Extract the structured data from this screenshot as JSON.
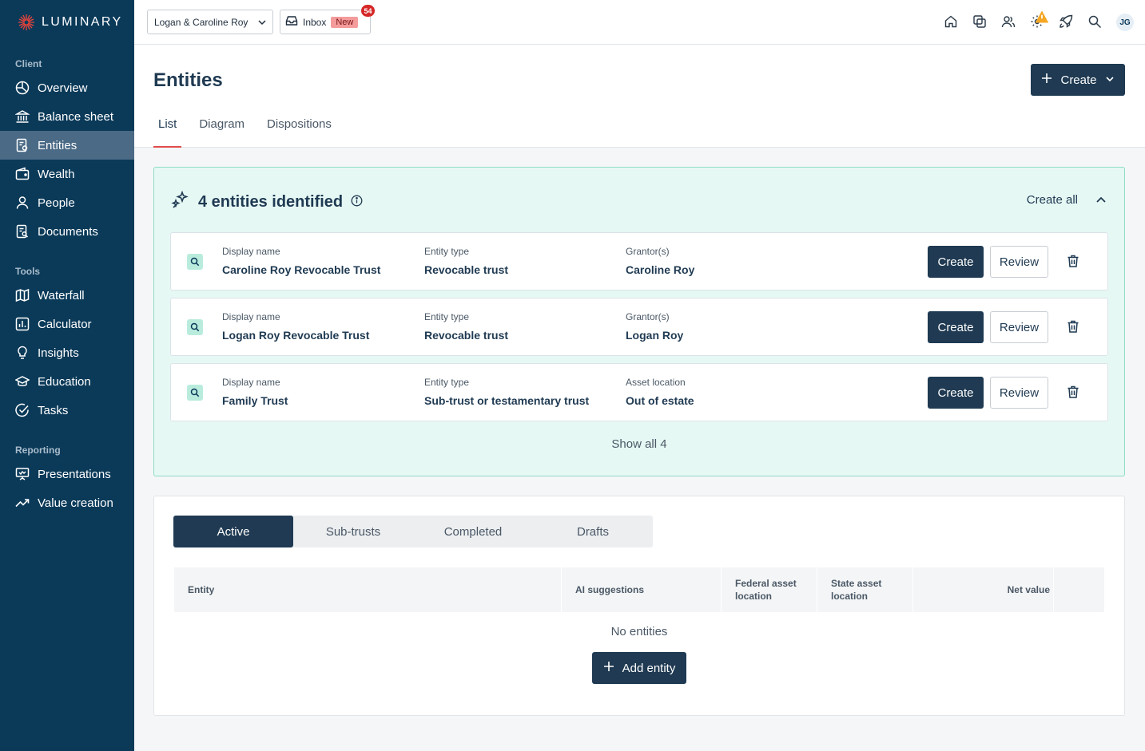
{
  "app": {
    "brand": "LUMINARY"
  },
  "colors": {
    "sidebar": "#0b3a59",
    "primary": "#1f3a52",
    "accent": "#e24b4b",
    "ai_panel": "#e6f8f4",
    "ai_border": "#8fdcc7"
  },
  "sidebar": {
    "sections": [
      {
        "label": "Client",
        "items": [
          {
            "label": "Overview",
            "icon": "pie-chart-icon",
            "active": false
          },
          {
            "label": "Balance sheet",
            "icon": "bank-icon",
            "active": false
          },
          {
            "label": "Entities",
            "icon": "entity-document-icon",
            "active": true
          },
          {
            "label": "Wealth",
            "icon": "wallet-icon",
            "active": false
          },
          {
            "label": "People",
            "icon": "person-icon",
            "active": false
          },
          {
            "label": "Documents",
            "icon": "document-search-icon",
            "active": false
          }
        ]
      },
      {
        "label": "Tools",
        "items": [
          {
            "label": "Waterfall",
            "icon": "map-icon",
            "active": false
          },
          {
            "label": "Calculator",
            "icon": "bar-chart-icon",
            "active": false
          },
          {
            "label": "Insights",
            "icon": "lightbulb-icon",
            "active": false
          },
          {
            "label": "Education",
            "icon": "graduation-cap-icon",
            "active": false
          },
          {
            "label": "Tasks",
            "icon": "check-circle-icon",
            "active": false
          }
        ]
      },
      {
        "label": "Reporting",
        "items": [
          {
            "label": "Presentations",
            "icon": "presentation-icon",
            "active": false
          },
          {
            "label": "Value creation",
            "icon": "trending-up-icon",
            "active": false
          }
        ]
      }
    ]
  },
  "topbar": {
    "client": "Logan & Caroline Roy",
    "inbox_label": "Inbox",
    "inbox_new": "New",
    "inbox_count": "54",
    "avatar_initials": "JG",
    "icons": [
      "home-icon",
      "copy-icon",
      "users-icon",
      "settings-warning-icon",
      "rocket-icon",
      "search-icon"
    ]
  },
  "page": {
    "title": "Entities",
    "create_label": "Create",
    "tabs": [
      "List",
      "Diagram",
      "Dispositions"
    ],
    "active_tab": "List"
  },
  "ai": {
    "title": "4 entities identified",
    "create_all": "Create all",
    "show_all": "Show all 4",
    "create_label": "Create",
    "review_label": "Review",
    "entities": [
      {
        "c1_label": "Display name",
        "c1_value": "Caroline Roy Revocable Trust",
        "c2_label": "Entity type",
        "c2_value": "Revocable trust",
        "c3_label": "Grantor(s)",
        "c3_value": "Caroline Roy"
      },
      {
        "c1_label": "Display name",
        "c1_value": "Logan Roy Revocable Trust",
        "c2_label": "Entity type",
        "c2_value": "Revocable trust",
        "c3_label": "Grantor(s)",
        "c3_value": "Logan Roy"
      },
      {
        "c1_label": "Display name",
        "c1_value": "Family Trust",
        "c2_label": "Entity type",
        "c2_value": "Sub-trust or testamentary trust",
        "c3_label": "Asset location",
        "c3_value": "Out of estate"
      }
    ]
  },
  "table": {
    "segments": [
      "Active",
      "Sub-trusts",
      "Completed",
      "Drafts"
    ],
    "active_segment": "Active",
    "columns": [
      "Entity",
      "AI suggestions",
      "Federal asset location",
      "State asset location",
      "Net value"
    ],
    "empty_text": "No entities",
    "add_label": "Add entity"
  }
}
